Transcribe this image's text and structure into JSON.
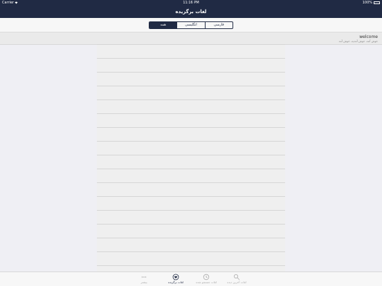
{
  "status": {
    "carrier": "Carrier",
    "time": "11:16 PM",
    "battery": "100%"
  },
  "nav": {
    "title": "لغات برگزیده"
  },
  "segments": [
    {
      "label": "فارسی",
      "active": false
    },
    {
      "label": "انگلیسی",
      "active": false
    },
    {
      "label": "همه",
      "active": true
    }
  ],
  "entries": [
    {
      "word": "welcome",
      "meaning": "خوش آمد، خوش آمدید، خوش آمد"
    }
  ],
  "tabs": [
    {
      "label": "لغات آخرین دیده",
      "icon": "search-icon"
    },
    {
      "label": "لغات جستجو شده",
      "icon": "history-icon"
    },
    {
      "label": "لغات برگزیده",
      "icon": "favorites-icon",
      "active": true
    },
    {
      "label": "بیشتر",
      "icon": "more-icon"
    }
  ]
}
